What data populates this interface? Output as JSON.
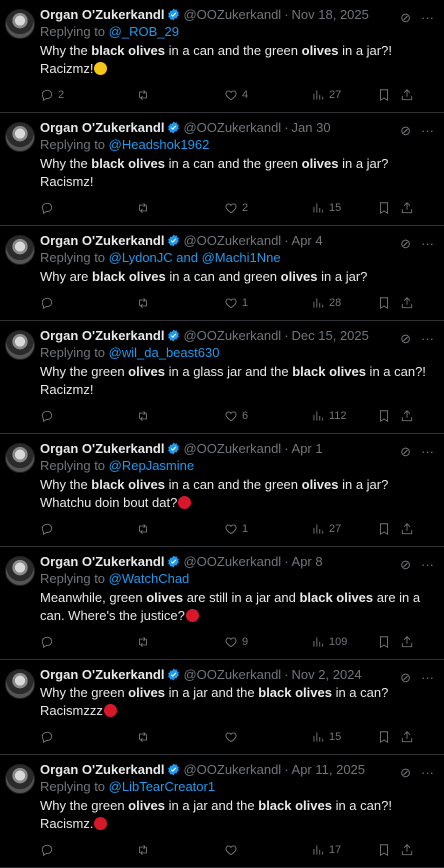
{
  "author": {
    "name": "Organ O'Zukerkandl",
    "handle": "@OOZukerkandl",
    "dot": "·"
  },
  "tweets": [
    {
      "date": "Nov 18, 2025",
      "replying_prefix": "Replying to ",
      "replying": "@_ROB_29",
      "replying_join": "",
      "replying2": "",
      "text_parts": [
        "Why the ",
        "black olives",
        " in a can and the green ",
        "olives",
        " in a jar?! Racizmz!"
      ],
      "emoji": "laugh",
      "replies": "2",
      "retweets": "",
      "likes": "4",
      "views": "27"
    },
    {
      "date": "Jan 30",
      "replying_prefix": "Replying to ",
      "replying": "@Headshok1962",
      "replying_join": "",
      "replying2": "",
      "text_parts": [
        "Why the ",
        "black olives",
        " in a can and the green ",
        "olives",
        " in a jar? Racismz!"
      ],
      "emoji": "",
      "replies": "",
      "retweets": "",
      "likes": "2",
      "views": "15"
    },
    {
      "date": "Apr 4",
      "replying_prefix": "Replying to ",
      "replying": "@LydonJC",
      "replying_join": " and ",
      "replying2": "@Machi1Nne",
      "text_parts": [
        "Why are ",
        "black olives",
        " in a can and green ",
        "olives",
        " in a jar?"
      ],
      "emoji": "",
      "replies": "",
      "retweets": "",
      "likes": "1",
      "views": "28"
    },
    {
      "date": "Dec 15, 2025",
      "replying_prefix": "Replying to ",
      "replying": "@wil_da_beast630",
      "replying_join": "",
      "replying2": "",
      "text_parts": [
        "Why the green ",
        "olives",
        " in a glass jar and the ",
        "black olives",
        " in a can?! Racizmz!"
      ],
      "emoji": "",
      "replies": "",
      "retweets": "",
      "likes": "6",
      "views": "112"
    },
    {
      "date": "Apr 1",
      "replying_prefix": "Replying to ",
      "replying": "@RepJasmine",
      "replying_join": "",
      "replying2": "",
      "text_parts": [
        "Why the ",
        "black olives",
        " in a can and the green ",
        "olives",
        " in a jar? Whatchu doin bout dat?"
      ],
      "emoji": "red",
      "replies": "",
      "retweets": "",
      "likes": "1",
      "views": "27"
    },
    {
      "date": "Apr 8",
      "replying_prefix": "Replying to ",
      "replying": "@WatchChad",
      "replying_join": "",
      "replying2": "",
      "text_parts": [
        "Meanwhile, green ",
        "olives",
        " are still in a jar and ",
        "black olives",
        " are in a can. Where's the justice?"
      ],
      "emoji": "red",
      "replies": "",
      "retweets": "",
      "likes": "9",
      "views": "109"
    },
    {
      "date": "Nov 2, 2024",
      "replying_prefix": "",
      "replying": "",
      "replying_join": "",
      "replying2": "",
      "text_parts": [
        "Why the green ",
        "olives",
        " in a jar and the ",
        "black olives",
        " in a can? Racismzzz"
      ],
      "emoji": "red",
      "replies": "",
      "retweets": "",
      "likes": "",
      "views": "15"
    },
    {
      "date": "Apr 11, 2025",
      "replying_prefix": "Replying to ",
      "replying": "@LibTearCreator1",
      "replying_join": "",
      "replying2": "",
      "text_parts": [
        "Why the green ",
        "olives",
        " in a jar and the ",
        "black olives",
        " in a can?! Racismz."
      ],
      "emoji": "red",
      "replies": "",
      "retweets": "",
      "likes": "",
      "views": "17"
    }
  ],
  "colors": {
    "background": "#000000",
    "text": "#e7e9ea",
    "muted": "#71767b",
    "link": "#1d9bf0",
    "verified": "#1d9bf0"
  }
}
